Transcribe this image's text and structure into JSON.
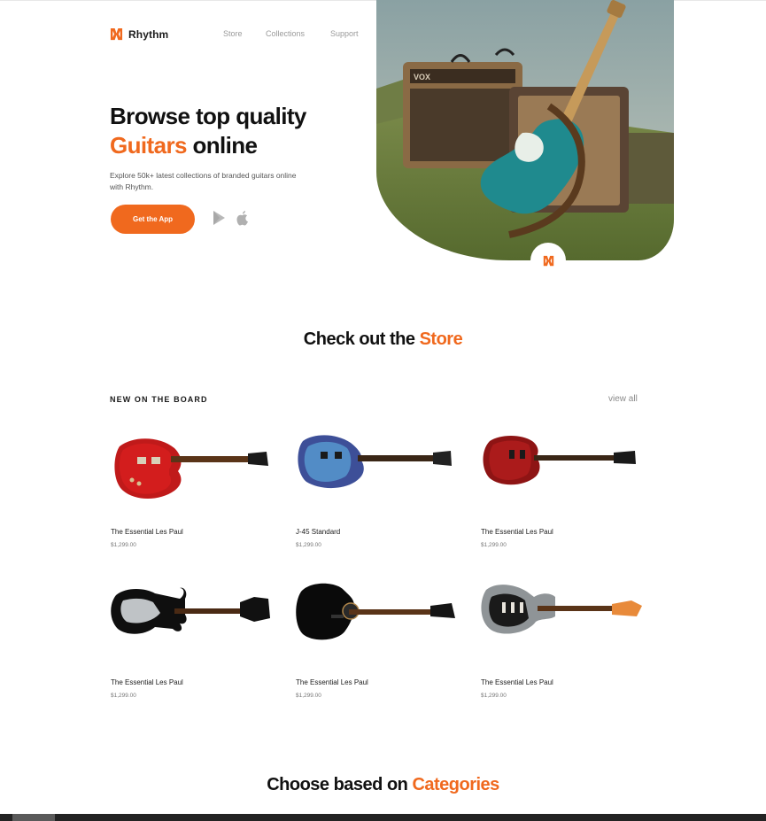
{
  "brand": {
    "name": "Rhythm",
    "color": "#f0691e"
  },
  "nav": {
    "items": [
      {
        "label": "Store"
      },
      {
        "label": "Collections"
      },
      {
        "label": "Support"
      }
    ]
  },
  "hero": {
    "title_line1": "Browse top quality",
    "title_accent": "Guitars",
    "title_rest": " online",
    "description": "Explore 50k+ latest collections of branded guitars online with Rhythm.",
    "cta_label": "Get the App",
    "store_icons": [
      "play-store-icon",
      "apple-icon"
    ]
  },
  "store_section": {
    "title_prefix": "Check out the ",
    "title_accent": "Store",
    "board_label": "NEW ON THE BOARD",
    "view_all": "view all",
    "products": [
      {
        "name": "The Essential Les Paul",
        "price": "$1,299.00",
        "image": "red-les-paul-guitar"
      },
      {
        "name": "J-45 Standard",
        "price": "$1,299.00",
        "image": "blue-burst-guitar"
      },
      {
        "name": "The Essential Les Paul",
        "price": "$1,299.00",
        "image": "cherry-red-guitar"
      },
      {
        "name": "The Essential Les Paul",
        "price": "$1,299.00",
        "image": "black-bass-guitar"
      },
      {
        "name": "The Essential Les Paul",
        "price": "$1,299.00",
        "image": "black-acoustic-guitar"
      },
      {
        "name": "The Essential Les Paul",
        "price": "$1,299.00",
        "image": "silver-stratocaster-guitar"
      }
    ]
  },
  "categories_section": {
    "title_prefix": "Choose based on ",
    "title_accent": "Categories"
  }
}
